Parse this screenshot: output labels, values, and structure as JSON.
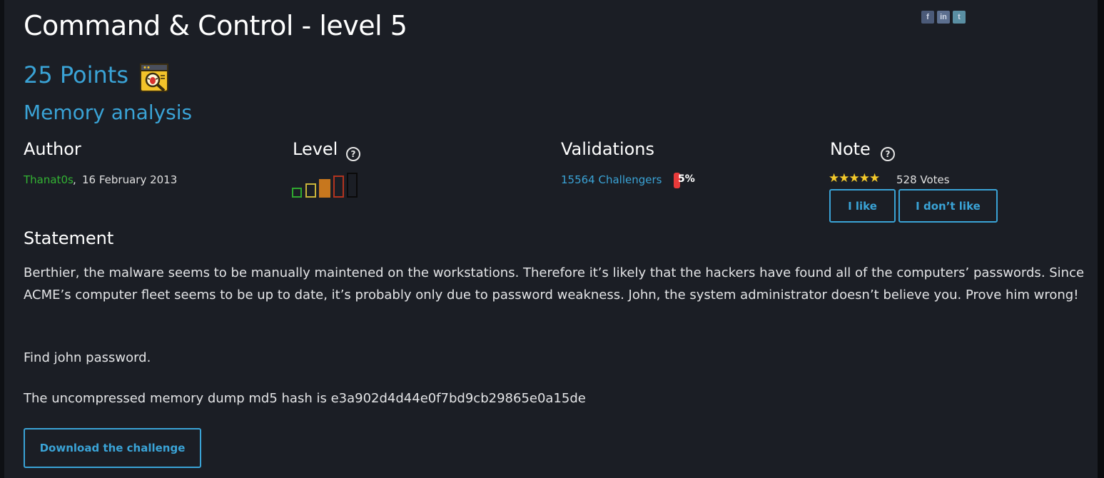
{
  "challenge": {
    "title": "Command & Control - level 5",
    "points": "25 Points",
    "points_icon": "bug-magnifier-icon",
    "category": "Memory analysis"
  },
  "social": [
    "facebook-icon",
    "linkedin-icon",
    "twitter-icon"
  ],
  "author": {
    "heading": "Author",
    "name": "Thanat0s",
    "separator": ",",
    "date": "16 February 2013"
  },
  "level": {
    "heading": "Level",
    "help": "?",
    "bars": [
      {
        "color": "#2fa82f",
        "filled": false
      },
      {
        "color": "#c9b43a",
        "filled": false
      },
      {
        "color": "#c7771e",
        "filled": true
      },
      {
        "color": "#b3341f",
        "filled": false
      },
      {
        "color": "#0a0a0a",
        "filled": false
      }
    ]
  },
  "validations": {
    "heading": "Validations",
    "challengers": "15564 Challengers",
    "percent": "5%",
    "bar_color": "#e83a3a"
  },
  "note": {
    "heading": "Note",
    "help": "?",
    "stars": "★★★★★",
    "votes": "528 Votes",
    "like_label": "I like",
    "dislike_label": "I don’t like"
  },
  "statement": {
    "heading": "Statement",
    "paragraphs": [
      "Berthier, the malware seems to be manually maintened on the workstations. Therefore it’s likely that the hackers have found all of the computers’ passwords. Since ACME’s computer fleet seems to be up to date, it’s probably only due to password weakness. John, the system administrator doesn’t believe you. Prove him wrong!",
      "Find john password.",
      "The uncompressed memory dump md5 hash is e3a902d4d44e0f7bd9cb29865e0a15de"
    ]
  },
  "download_label": "Download the challenge"
}
